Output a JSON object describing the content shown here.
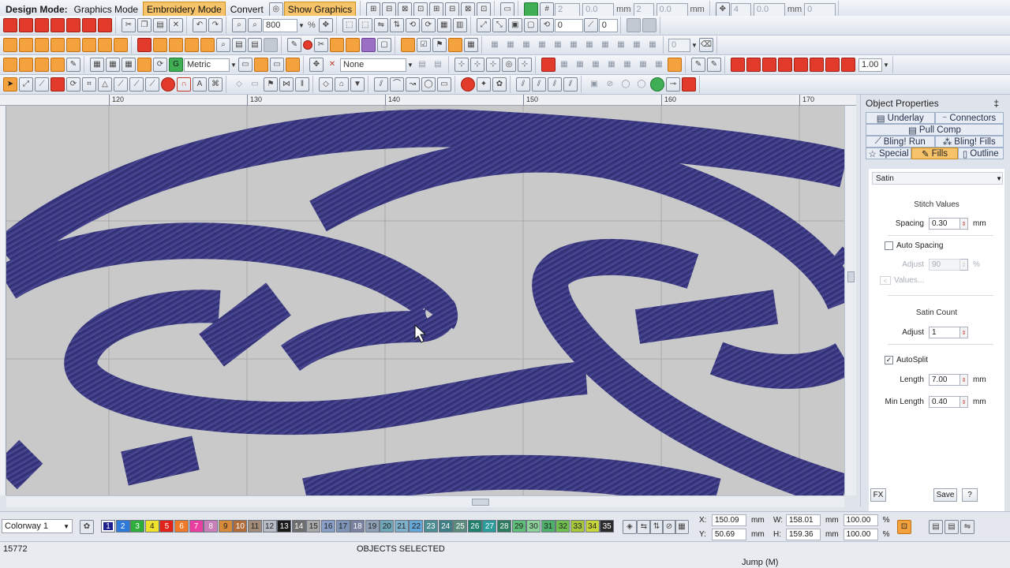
{
  "mode_bar": {
    "label": "Design Mode:",
    "modes": [
      "Graphics Mode",
      "Embroidery Mode",
      "Convert"
    ],
    "active_mode": "Embroidery Mode",
    "show_graphics": "Show Graphics",
    "zoom": "800",
    "zoom_unit": "%",
    "fields_row1": [
      "2",
      "0.0",
      "2",
      "0.0",
      "4",
      "0.0",
      "0"
    ],
    "unit_mm": "mm",
    "unit_deg": "°",
    "rotation_value": "0",
    "slant_value": "0",
    "row2_value": "0"
  },
  "toolbar3": {
    "units": "Metric",
    "connector": "None",
    "line_width": "1.00"
  },
  "ruler": {
    "labels": [
      "120",
      "130",
      "140",
      "150",
      "160",
      "170"
    ]
  },
  "panel": {
    "title": "Object Properties",
    "pin": "‡",
    "tabs_row1": [
      "Underlay",
      "Connectors"
    ],
    "tabs_row2": [
      "Pull Comp"
    ],
    "tabs_row3": [
      "Bling! Run",
      "Bling! Fills"
    ],
    "tabs_row4": [
      "Special",
      "Fills",
      "Outline"
    ],
    "fill_type": "Satin",
    "stitch_values_title": "Stitch Values",
    "spacing_label": "Spacing",
    "spacing_value": "0.30",
    "auto_spacing_label": "Auto Spacing",
    "adjust_label": "Adjust",
    "adjust_value": "90",
    "percent": "%",
    "values_label": "Values...",
    "satin_count_title": "Satin Count",
    "satin_adjust_label": "Adjust",
    "satin_adjust_value": "1",
    "autosplit_label": "AutoSplit",
    "length_label": "Length",
    "length_value": "7.00",
    "min_length_label": "Min Length",
    "min_length_value": "0.40",
    "unit": "mm",
    "fx_label": "FX",
    "save_label": "Save",
    "help_label": "?"
  },
  "colorway": {
    "name": "Colorway 1",
    "swatches": [
      {
        "n": "1",
        "color": "#1d1f8c",
        "text": "#ffffff"
      },
      {
        "n": "2",
        "color": "#2f7ad9",
        "text": "#ffffff"
      },
      {
        "n": "3",
        "color": "#2fae3b",
        "text": "#ffffff"
      },
      {
        "n": "4",
        "color": "#f0e12b",
        "text": "#222222"
      },
      {
        "n": "5",
        "color": "#e2231a",
        "text": "#ffffff"
      },
      {
        "n": "6",
        "color": "#f07a2a",
        "text": "#ffffff"
      },
      {
        "n": "7",
        "color": "#e83fa0",
        "text": "#ffffff"
      },
      {
        "n": "8",
        "color": "#c97fb8",
        "text": "#ffffff"
      },
      {
        "n": "9",
        "color": "#d68a3a",
        "text": "#222222"
      },
      {
        "n": "10",
        "color": "#b06d3a",
        "text": "#ffffff"
      },
      {
        "n": "11",
        "color": "#a08c78",
        "text": "#222222"
      },
      {
        "n": "12",
        "color": "#b8bcc4",
        "text": "#222222"
      },
      {
        "n": "13",
        "color": "#1a1a1a",
        "text": "#ffffff"
      },
      {
        "n": "14",
        "color": "#6e6e6e",
        "text": "#ffffff"
      },
      {
        "n": "15",
        "color": "#a8a8a8",
        "text": "#222222"
      },
      {
        "n": "16",
        "color": "#8a9fc8",
        "text": "#222222"
      },
      {
        "n": "17",
        "color": "#7e93b6",
        "text": "#222222"
      },
      {
        "n": "18",
        "color": "#7a82a0",
        "text": "#ffffff"
      },
      {
        "n": "19",
        "color": "#8fa0b5",
        "text": "#222222"
      },
      {
        "n": "20",
        "color": "#6fa7b8",
        "text": "#222222"
      },
      {
        "n": "21",
        "color": "#7fb0c9",
        "text": "#222222"
      },
      {
        "n": "22",
        "color": "#64a7d6",
        "text": "#222222"
      },
      {
        "n": "23",
        "color": "#4c8d92",
        "text": "#ffffff"
      },
      {
        "n": "24",
        "color": "#3f7f83",
        "text": "#ffffff"
      },
      {
        "n": "25",
        "color": "#5b8c7c",
        "text": "#ffffff"
      },
      {
        "n": "26",
        "color": "#1f7f6a",
        "text": "#ffffff"
      },
      {
        "n": "27",
        "color": "#2a9c9a",
        "text": "#ffffff"
      },
      {
        "n": "28",
        "color": "#2e7a5f",
        "text": "#ffffff"
      },
      {
        "n": "29",
        "color": "#5fbf7a",
        "text": "#222222"
      },
      {
        "n": "30",
        "color": "#8fd19a",
        "text": "#222222"
      },
      {
        "n": "31",
        "color": "#4fb06a",
        "text": "#222222"
      },
      {
        "n": "32",
        "color": "#70bf4f",
        "text": "#222222"
      },
      {
        "n": "33",
        "color": "#a6c83a",
        "text": "#222222"
      },
      {
        "n": "34",
        "color": "#c7d63a",
        "text": "#222222"
      },
      {
        "n": "35",
        "color": "#2b2b2b",
        "text": "#ffffff"
      }
    ]
  },
  "coords": {
    "x_label": "X:",
    "x_value": "150.09",
    "y_label": "Y:",
    "y_value": "50.69",
    "w_label": "W:",
    "w_value": "158.01",
    "h_label": "H:",
    "h_value": "159.36",
    "w_pct": "100.00",
    "h_pct": "100.00",
    "unit": "mm",
    "pct": "%"
  },
  "status": {
    "stitch_count": "15772",
    "selection": "OBJECTS SELECTED",
    "jump": "Jump (M)"
  },
  "colors": {
    "thread": "#3b3a82",
    "canvas_bg": "#c9c9c9",
    "accent": "#f6c26a"
  }
}
